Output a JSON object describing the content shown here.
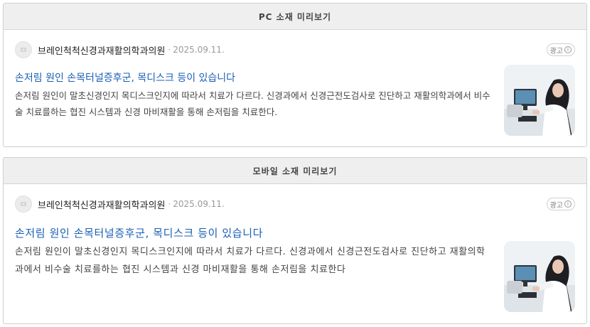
{
  "pc": {
    "header": "PC 소재 미리보기",
    "advertiser": "브레인척척신경과재활의학과의원",
    "separator": "·",
    "date": "2025.09.11.",
    "ad_badge": "광고",
    "title": "손저림 원인 손목터널증후군, 목디스크 등이 있습니다",
    "description": "손저림 원인이 말초신경인지 목디스크인지에 따라서 치료가 다르다. 신경과에서 신경근전도검사로 진단하고 재활의학과에서 비수술 치료를하는 협진 시스템과 신경 마비재활을 통해 손저림을 치료한다.",
    "thumbnail_icon": "doctor-at-computer-photo"
  },
  "mobile": {
    "header": "모바일 소재 미리보기",
    "advertiser": "브레인척척신경과재활의학과의원",
    "separator": "·",
    "date": "2025.09.11.",
    "ad_badge": "광고",
    "title": "손저림 원인 손목터널증후군, 목디스크 등이 있습니다",
    "description": "손저림 원인이 말초신경인지 목디스크인지에 따라서 치료가 다르다. 신경과에서 신경근전도검사로 진단하고 재활의학과에서 비수술 치료를하는 협진 시스템과 신경 마비재활을 통해 손저림을 치료한다",
    "thumbnail_icon": "doctor-at-computer-photo"
  },
  "colors": {
    "title_link": "#1a5fb4",
    "header_bg": "#efefef",
    "border": "#cfcfcf"
  }
}
